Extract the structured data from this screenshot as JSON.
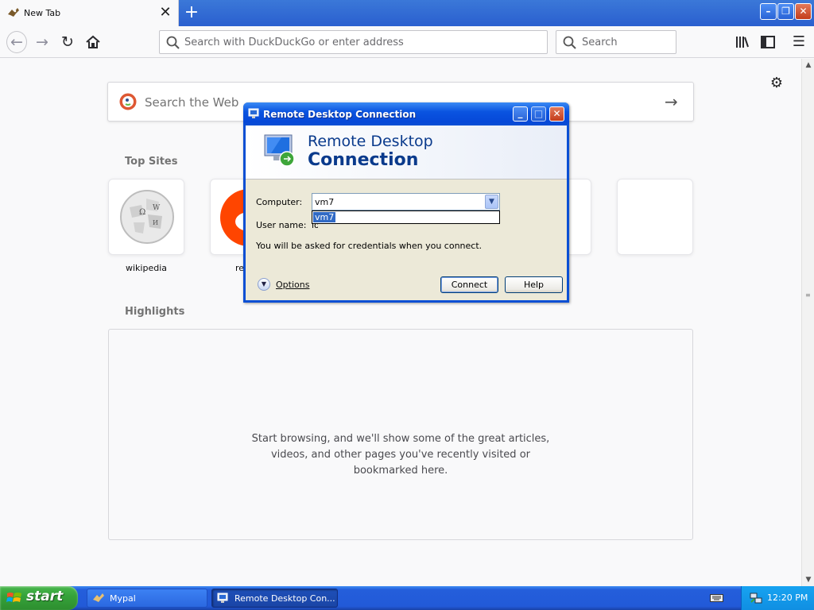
{
  "browser": {
    "tab": {
      "title": "New Tab",
      "close_label": "✕"
    },
    "new_tab_label": "+",
    "window_controls": {
      "minimize": "–",
      "restore": "❐",
      "close": "✕"
    },
    "urlbar": {
      "placeholder": "Search with DuckDuckGo or enter address"
    },
    "searchbar": {
      "placeholder": "Search"
    }
  },
  "newtab": {
    "web_search_placeholder": "Search the Web",
    "top_sites_title": "Top Sites",
    "top_sites": [
      {
        "label": "wikipedia"
      },
      {
        "label": "re"
      }
    ],
    "highlights_title": "Highlights",
    "highlights_message": [
      "Start browsing, and we'll show some of the great articles,",
      "videos, and other pages you've recently visited or",
      "bookmarked here."
    ]
  },
  "rdp_dialog": {
    "title": "Remote Desktop Connection",
    "banner_line1": "Remote Desktop",
    "banner_line2": "Connection",
    "computer_label": "Computer:",
    "computer_value": "vm7",
    "dropdown_option": "vm7",
    "username_label": "User name:",
    "username_value": "lor",
    "credentials_note": "You will be asked for credentials when you connect.",
    "options_label": "Options",
    "connect_label": "Connect",
    "help_label": "Help",
    "controls": {
      "minimize": "_",
      "maximize": "□",
      "close": "✕"
    }
  },
  "taskbar": {
    "start_label": "start",
    "tasks": [
      {
        "label": "Mypal"
      },
      {
        "label": "Remote Desktop Con..."
      }
    ],
    "clock": "12:20 PM"
  },
  "colors": {
    "xp_blue": "#0a4fd4",
    "start_green": "#36a33b",
    "ddg_orange": "#de5833",
    "reddit_orange": "#ff4500"
  }
}
